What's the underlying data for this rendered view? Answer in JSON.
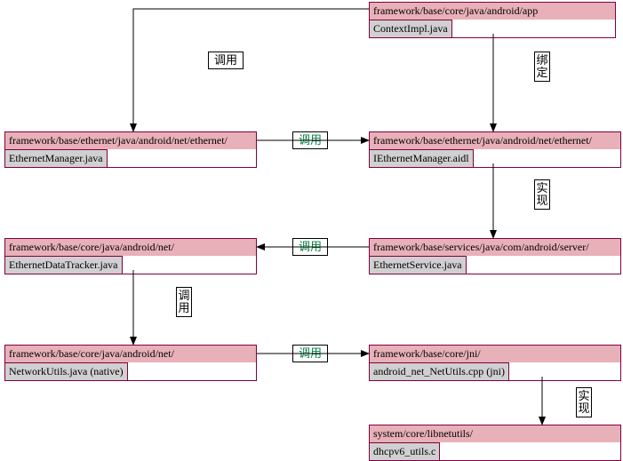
{
  "nodes": {
    "app": {
      "path": "framework/base/core/java/android/app",
      "file": "ContextImpl.java"
    },
    "ethernetMgr": {
      "path": "framework/base/ethernet/java/android/net/ethernet/",
      "file": "EthernetManager.java"
    },
    "iethernetMgr": {
      "path": "framework/base/ethernet/java/android/net/ethernet/",
      "file": "IEthernetManager.aidl"
    },
    "dataTracker": {
      "path": "framework/base/core/java/android/net/",
      "file": "EthernetDataTracker.java"
    },
    "ethernetService": {
      "path": "framework/base/services/java/com/android/server/",
      "file": "EthernetService.java"
    },
    "networkUtils": {
      "path": "framework/base/core/java/android/net/",
      "file": "NetworkUtils.java      (native)"
    },
    "jni": {
      "path": "framework/base/core/jni/",
      "file": "android_net_NetUtils.cpp     (jni)"
    },
    "libnetutils": {
      "path": "system/core/libnetutils/",
      "file": "dhcpv6_utils.c"
    }
  },
  "labels": {
    "call": "调用",
    "bind": "绑定",
    "impl": "实现"
  },
  "colors": {
    "nodePath": "#e8b0b8",
    "nodeFile": "#d0d0d0",
    "border": "#800040",
    "arrow": "#000000",
    "labelCall": "#008040"
  }
}
